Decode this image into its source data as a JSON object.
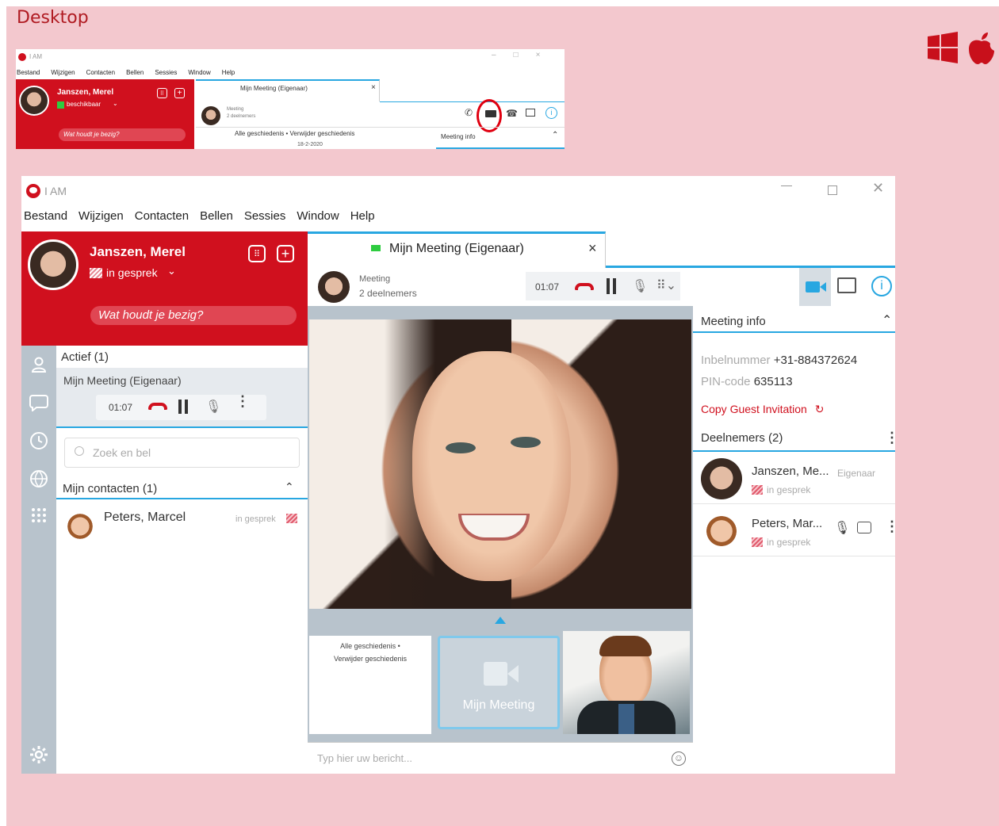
{
  "section_title": "Desktop",
  "app_name": "I AM",
  "menu": [
    "Bestand",
    "Wijzigen",
    "Contacten",
    "Bellen",
    "Sessies",
    "Window",
    "Help"
  ],
  "small": {
    "user_name": "Janszen, Merel",
    "status": "beschikbaar",
    "status_prompt": "Wat houdt je bezig?",
    "tab_title": "Mijn Meeting (Eigenaar)",
    "tab_close": "×",
    "meeting_label": "Meeting",
    "participants": "2 deelnemers",
    "history_link": "Alle geschiedenis",
    "delete_history": "Verwijder geschiedenis",
    "date": "18-2-2020",
    "meeting_info": "Meeting info"
  },
  "main": {
    "user_name": "Janszen, Merel",
    "status": "in gesprek",
    "status_prompt": "Wat houdt je bezig?",
    "tab_title": "Mijn Meeting (Eigenaar)",
    "tab_close": "×",
    "meeting_label": "Meeting",
    "participants": "2 deelnemers",
    "timer": "01:07",
    "active_header": "Actief (1)",
    "active_call": "Mijn Meeting (Eigenaar)",
    "search_placeholder": "Zoek en bel",
    "contacts_header": "Mijn contacten (1)",
    "contacts": [
      {
        "name": "Peters, Marcel",
        "status": "in gesprek"
      }
    ],
    "meeting_info": {
      "title": "Meeting info",
      "dial_label": "Inbelnummer",
      "dial_number": "+31-884372624",
      "pin_label": "PIN-code",
      "pin": "635113",
      "copy_link": "Copy Guest Invitation",
      "participants_header": "Deelnemers (2)",
      "participants": [
        {
          "name": "Janszen, Me...",
          "role": "Eigenaar",
          "status": "in gesprek"
        },
        {
          "name": "Peters, Mar...",
          "role": "",
          "status": "in gesprek"
        }
      ]
    },
    "history_line1": "Alle geschiedenis •",
    "history_line2": "Verwijder geschiedenis",
    "thumb_meeting": "Mijn Meeting",
    "message_placeholder": "Typ hier uw bericht..."
  },
  "colors": {
    "brand_red": "#d0101e",
    "page_bg": "#f3c8ce",
    "accent_blue": "#28a7e1",
    "title_red": "#b01b22"
  }
}
